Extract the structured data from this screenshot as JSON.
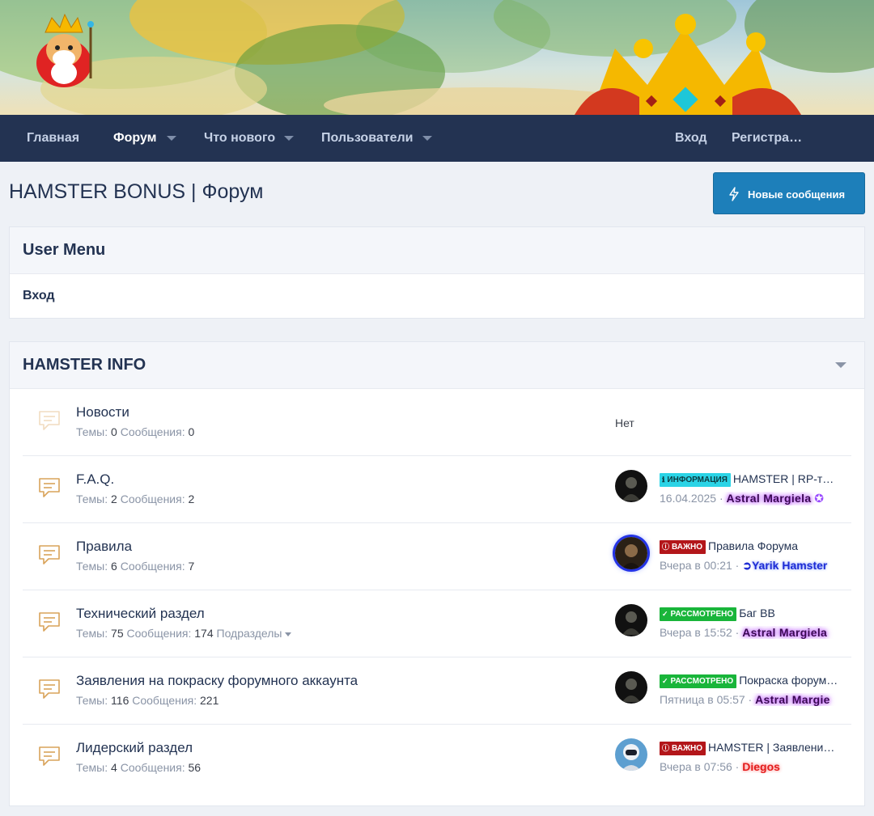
{
  "nav": {
    "items": [
      {
        "label": "Главная"
      },
      {
        "label": "Форум"
      },
      {
        "label": "Что нового"
      },
      {
        "label": "Пользователи"
      }
    ],
    "login": "Вход",
    "register": "Регистра…",
    "search_icon": "search-icon"
  },
  "page": {
    "title": "HAMSTER BONUS | Форум",
    "new_posts_button": "Новые сообщения"
  },
  "user_menu": {
    "title": "User Menu",
    "login": "Вход"
  },
  "category": {
    "title": "HAMSTER INFO",
    "forums": [
      {
        "name": "Новости",
        "themes_label": "Темы:",
        "themes": "0",
        "posts_label": "Сообщения:",
        "posts": "0",
        "last": "Нет"
      },
      {
        "name": "F.A.Q.",
        "themes_label": "Темы:",
        "themes": "2",
        "posts_label": "Сообщения:",
        "posts": "2",
        "prefix": "ИНФОРМАЦИЯ",
        "prefix_color": "#2bd4e6",
        "thread": "HAMSTER | RP-т…",
        "date": "16.04.2025",
        "user": "Astral Margiela"
      },
      {
        "name": "Правила",
        "themes_label": "Темы:",
        "themes": "6",
        "posts_label": "Сообщения:",
        "posts": "7",
        "prefix": "ВАЖНО",
        "prefix_color": "#b3161a",
        "thread": "Правила Форума",
        "date": "Вчера в 00:21",
        "user": "Yarik Hamster"
      },
      {
        "name": "Технический раздел",
        "themes_label": "Темы:",
        "themes": "75",
        "posts_label": "Сообщения:",
        "posts": "174",
        "subforums": "Подразделы",
        "prefix": "РАССМОТРЕНО",
        "prefix_color": "#19b53a",
        "thread": "Баг BB",
        "date": "Вчера в 15:52",
        "user": "Astral Margiela"
      },
      {
        "name": "Заявления на покраску форумного аккаунта",
        "themes_label": "Темы:",
        "themes": "116",
        "posts_label": "Сообщения:",
        "posts": "221",
        "prefix": "РАССМОТРЕНО",
        "prefix_color": "#19b53a",
        "thread": "Покраска форум…",
        "date": "Пятница в 05:57",
        "user": "Astral Margie"
      },
      {
        "name": "Лидерский раздел",
        "themes_label": "Темы:",
        "themes": "4",
        "posts_label": "Сообщения:",
        "posts": "56",
        "prefix": "ВАЖНО",
        "prefix_color": "#b3161a",
        "thread": "HAMSTER | Заявление…",
        "date": "Вчера в 07:56",
        "user": "Diegos"
      }
    ]
  }
}
